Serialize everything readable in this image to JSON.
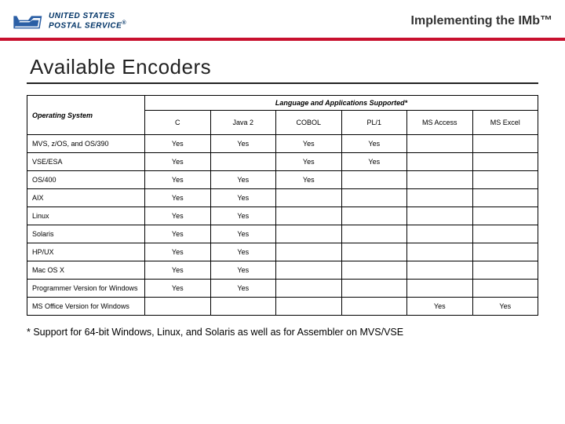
{
  "header": {
    "logo_line1": "UNITED STATES",
    "logo_line2": "POSTAL SERVICE",
    "logo_reg": "®",
    "title": "Implementing the IMb™"
  },
  "section": {
    "title": "Available Encoders",
    "footnote": "* Support for 64-bit Windows, Linux, and Solaris as well as for Assembler on MVS/VSE"
  },
  "chart_data": {
    "type": "table",
    "os_header": "Operating System",
    "lang_header": "Language and Applications Supported*",
    "columns": [
      "C",
      "Java 2",
      "COBOL",
      "PL/1",
      "MS Access",
      "MS Excel"
    ],
    "rows": [
      {
        "os": "MVS, z/OS, and OS/390",
        "values": [
          "Yes",
          "Yes",
          "Yes",
          "Yes",
          "",
          ""
        ]
      },
      {
        "os": "VSE/ESA",
        "values": [
          "Yes",
          "",
          "Yes",
          "Yes",
          "",
          ""
        ]
      },
      {
        "os": "OS/400",
        "values": [
          "Yes",
          "Yes",
          "Yes",
          "",
          "",
          ""
        ]
      },
      {
        "os": "AIX",
        "values": [
          "Yes",
          "Yes",
          "",
          "",
          "",
          ""
        ]
      },
      {
        "os": "Linux",
        "values": [
          "Yes",
          "Yes",
          "",
          "",
          "",
          ""
        ]
      },
      {
        "os": "Solaris",
        "values": [
          "Yes",
          "Yes",
          "",
          "",
          "",
          ""
        ]
      },
      {
        "os": "HP/UX",
        "values": [
          "Yes",
          "Yes",
          "",
          "",
          "",
          ""
        ]
      },
      {
        "os": "Mac OS X",
        "values": [
          "Yes",
          "Yes",
          "",
          "",
          "",
          ""
        ]
      },
      {
        "os": "Programmer Version for Windows",
        "values": [
          "Yes",
          "Yes",
          "",
          "",
          "",
          ""
        ]
      },
      {
        "os": "MS Office Version for Windows",
        "values": [
          "",
          "",
          "",
          "",
          "Yes",
          "Yes"
        ]
      }
    ]
  }
}
